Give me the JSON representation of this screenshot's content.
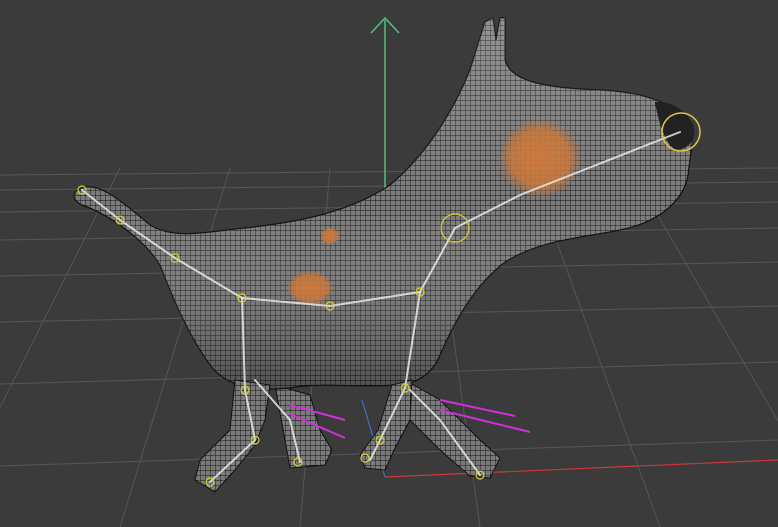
{
  "viewport": {
    "background": "#3b3b3b",
    "grid_color": "#575757",
    "x_axis_color": "#c93a3a",
    "y_axis_color": "#3fbf74",
    "z_axis_color": "#3a6fd1"
  },
  "model": {
    "mesh_fill": "#7b7b7b",
    "wire_color": "#111111",
    "spot_color": "#c8783c",
    "nose_color": "#222222"
  },
  "rig": {
    "bone_color": "#e8e8e8",
    "joint_color": "#d7d230",
    "selected_joint_color": "#e3c840",
    "ik_handle_color": "#d030d8",
    "manipulator_color": "#4ec27f"
  }
}
